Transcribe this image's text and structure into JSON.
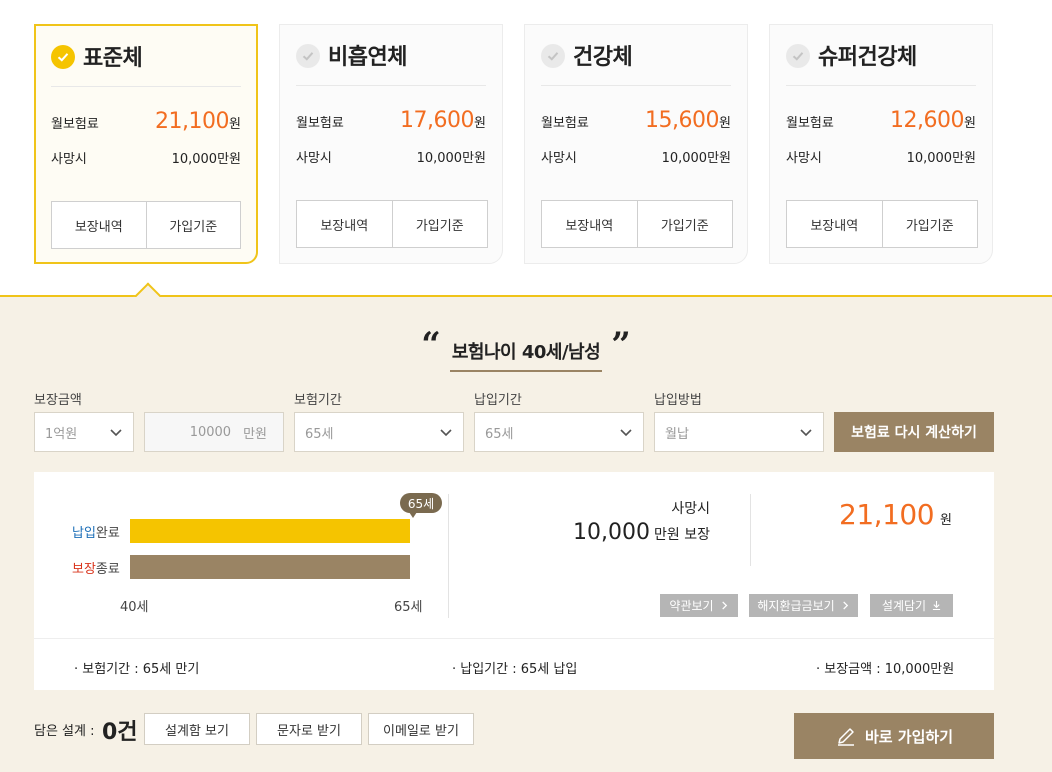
{
  "plans": [
    {
      "name": "표준체",
      "premium_label": "월보험료",
      "premium": "21,100",
      "won": "원",
      "death_label": "사망시",
      "death_value": "10,000만원",
      "btn_coverage": "보장내역",
      "btn_criteria": "가입기준",
      "selected": true
    },
    {
      "name": "비흡연체",
      "premium_label": "월보험료",
      "premium": "17,600",
      "won": "원",
      "death_label": "사망시",
      "death_value": "10,000만원",
      "btn_coverage": "보장내역",
      "btn_criteria": "가입기준",
      "selected": false
    },
    {
      "name": "건강체",
      "premium_label": "월보험료",
      "premium": "15,600",
      "won": "원",
      "death_label": "사망시",
      "death_value": "10,000만원",
      "btn_coverage": "보장내역",
      "btn_criteria": "가입기준",
      "selected": false
    },
    {
      "name": "슈퍼건강체",
      "premium_label": "월보험료",
      "premium": "12,600",
      "won": "원",
      "death_label": "사망시",
      "death_value": "10,000만원",
      "btn_coverage": "보장내역",
      "btn_criteria": "가입기준",
      "selected": false
    }
  ],
  "headline": {
    "open_quote": "“",
    "text": "보험나이 40세/남성",
    "close_quote": "”"
  },
  "form": {
    "amount_label": "보장금액",
    "amount_select": "1억원",
    "amount_input_value": "10000",
    "amount_input_unit": "만원",
    "period_label": "보험기간",
    "period_select": "65세",
    "pay_period_label": "납입기간",
    "pay_period_select": "65세",
    "pay_method_label": "납입방법",
    "pay_method_select": "월납",
    "recalc_button": "보험료 다시 계산하기"
  },
  "chart": {
    "row1_label_a": "납입",
    "row1_label_b": "완료",
    "row2_label_a": "보장",
    "row2_label_b": "종료",
    "age_tag": "65세",
    "tick_start": "40세",
    "tick_end": "65세",
    "accent_blue": "#1d6fb8",
    "accent_red": "#d9341c"
  },
  "chart_data": {
    "type": "bar",
    "orientation": "horizontal",
    "categories": [
      "납입완료",
      "보장종료"
    ],
    "series": [
      {
        "values": [
          65,
          65
        ]
      }
    ],
    "xlim": [
      40,
      65
    ],
    "xticks": [
      "40세",
      "65세"
    ],
    "annotation": "65세",
    "colors": [
      "#f5c400",
      "#9a8464"
    ]
  },
  "summary": {
    "death_label": "사망시",
    "death_amount": "10,000",
    "death_unit": "만원 보장",
    "premium": "21,100",
    "premium_unit": "원"
  },
  "actions": {
    "terms": "약관보기",
    "refund": "해지환급금보기",
    "save": "설계담기"
  },
  "info": {
    "period": "보험기간 : 65세 만기",
    "pay_period": "납입기간 : 65세 납입",
    "amount": "보장금액 : 10,000만원"
  },
  "footer": {
    "saved_label": "담은 설계 :",
    "saved_count": "0건",
    "view_saved": "설계함 보기",
    "sms": "문자로 받기",
    "email": "이메일로 받기",
    "join": "바로 가입하기"
  },
  "colors": {
    "accent_yellow": "#f0c419",
    "accent_orange": "#f26d21",
    "brand_brown": "#9a8464",
    "panel_bg": "#f6f1e6"
  }
}
